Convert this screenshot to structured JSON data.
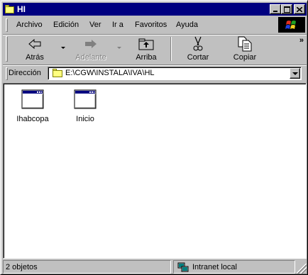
{
  "window": {
    "title": "HI"
  },
  "menu": {
    "items": [
      "Archivo",
      "Edición",
      "Ver",
      "Ir a",
      "Favoritos",
      "Ayuda"
    ]
  },
  "toolbar": {
    "back_label": "Atrás",
    "forward_label": "Adelante",
    "up_label": "Arriba",
    "cut_label": "Cortar",
    "copy_label": "Copiar",
    "more": "»"
  },
  "address": {
    "label": "Dirección",
    "value": "E:\\CGW\\INSTALA\\IVA\\HL"
  },
  "files": [
    {
      "name": "Ihabcopa"
    },
    {
      "name": "Inicio"
    }
  ],
  "status": {
    "count": "2 objetos",
    "zone": "Intranet local"
  },
  "colors": {
    "titlebar": "#000080",
    "face": "#c0c0c0"
  }
}
